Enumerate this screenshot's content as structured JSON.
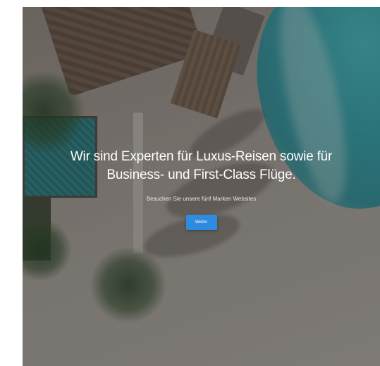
{
  "hero": {
    "headline_line1": "Wir sind Experten für Luxus-Reisen sowie für",
    "headline_line2": "Business- und First-Class Flüge.",
    "subtitle": "Besuchen Sie unsere fünf Marken Websites",
    "button_label": "Weiter",
    "accent_color": "#2f8be0"
  }
}
